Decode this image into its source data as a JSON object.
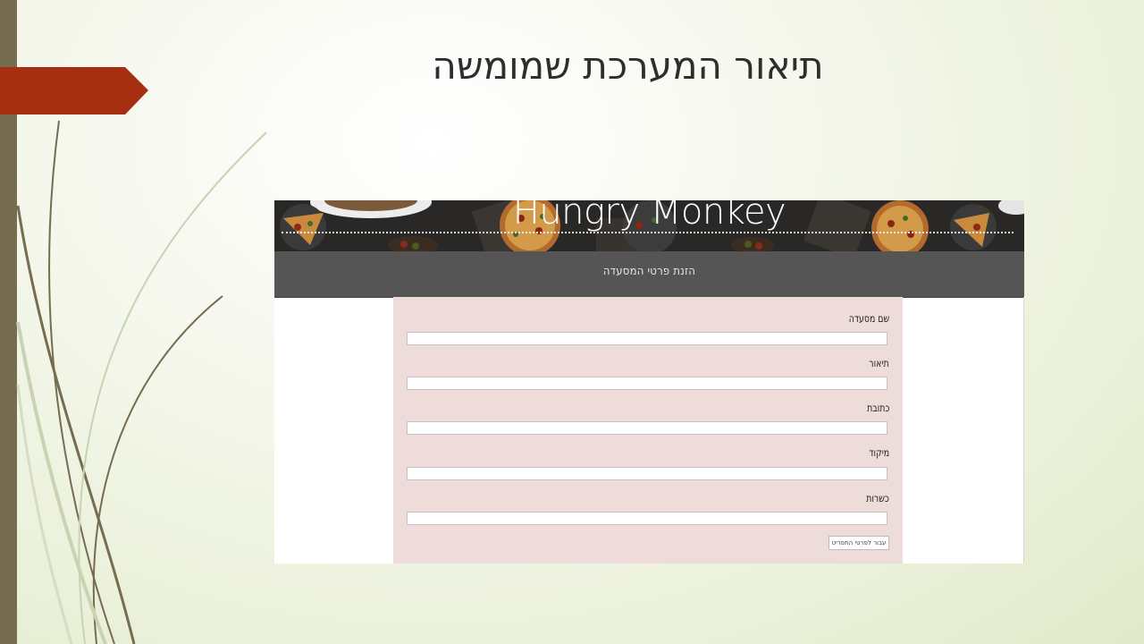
{
  "slide": {
    "title": "תיאור המערכת שמומשה"
  },
  "screenshot": {
    "brand_title": "Hungry Monkey",
    "nav_title": "הזנת פרטי המסעדה",
    "form": {
      "fields": [
        {
          "label": "שם מסעדה",
          "value": ""
        },
        {
          "label": "תיאור",
          "value": ""
        },
        {
          "label": "כתובת",
          "value": ""
        },
        {
          "label": "מיקוד",
          "value": ""
        },
        {
          "label": "כשרות",
          "value": ""
        }
      ],
      "submit_label": "עבור לפרטי התפריט"
    }
  },
  "colors": {
    "left_bar": "#766d51",
    "arrow_tab": "#a52f10",
    "nav_strip": "#555555",
    "form_panel": "#eedcdb"
  }
}
